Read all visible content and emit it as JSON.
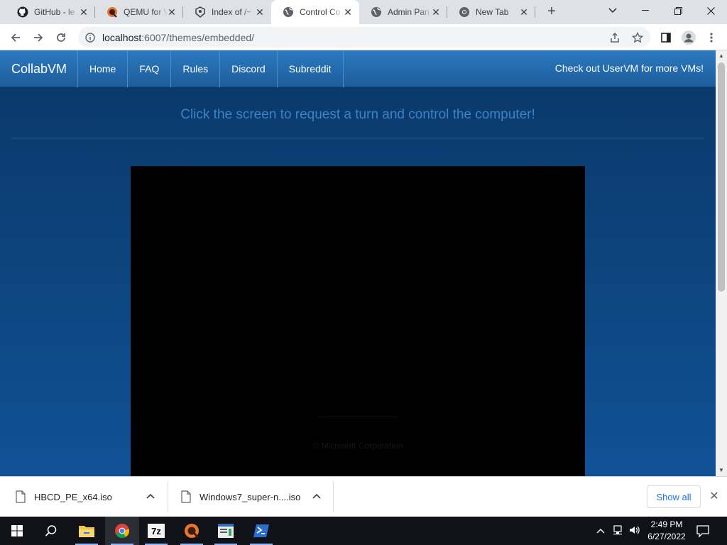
{
  "browser": {
    "tabs": [
      {
        "title": "GitHub - le",
        "icon": "github-icon"
      },
      {
        "title": "QEMU for W",
        "icon": "qemu-icon"
      },
      {
        "title": "Index of /~",
        "icon": "index-icon"
      },
      {
        "title": "Control Co",
        "icon": "globe-icon",
        "active": true
      },
      {
        "title": "Admin Pan",
        "icon": "globe-icon"
      },
      {
        "title": "New Tab",
        "icon": "chrome-icon"
      }
    ],
    "address": {
      "host": "localhost",
      "rest": ":6007/themes/embedded/"
    }
  },
  "site": {
    "brand": "CollabVM",
    "nav": [
      "Home",
      "FAQ",
      "Rules",
      "Discord",
      "Subreddit"
    ],
    "nav_right": "Check out UserVM for more VMs!",
    "prompt": "Click the screen to request a turn and control the computer!",
    "vm_copyright": "© Microsoft Corporation"
  },
  "downloads": {
    "items": [
      {
        "name": "HBCD_PE_x64.iso"
      },
      {
        "name": "Windows7_super-n....iso"
      }
    ],
    "show_all": "Show all"
  },
  "taskbar": {
    "time": "2:49 PM",
    "date": "6/27/2022",
    "apps": [
      "start",
      "search",
      "file-explorer",
      "chrome",
      "7zip",
      "qemu",
      "notepad",
      "powershell"
    ]
  },
  "colors": {
    "navbar": "#2c7ac0",
    "page_background": "#0d4782",
    "prompt_text": "#3b83c6",
    "link_blue": "#1a73e8"
  }
}
